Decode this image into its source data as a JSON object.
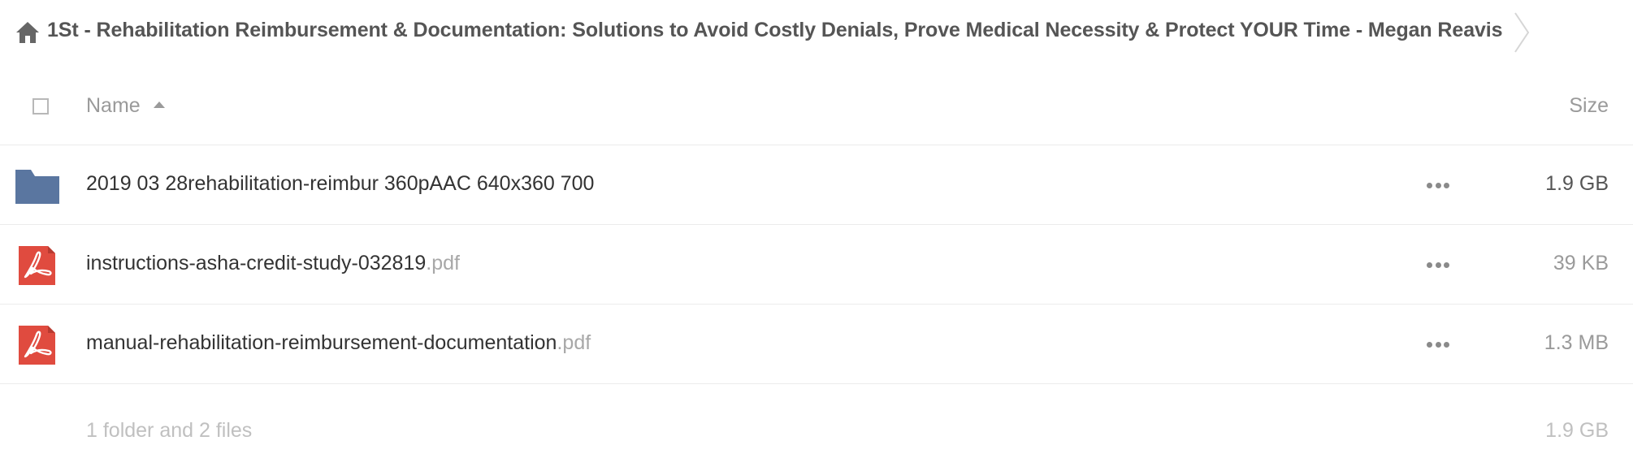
{
  "breadcrumb": {
    "home_icon": "home-icon",
    "title": "1St - Rehabilitation Reimbursement & Documentation: Solutions to Avoid Costly Denials, Prove Medical Necessity & Protect YOUR Time - Megan Reavis"
  },
  "header": {
    "name_label": "Name",
    "size_label": "Size",
    "sort": "ascending"
  },
  "files": [
    {
      "icon": "folder-icon",
      "name": "2019 03 28rehabilitation-reimbur 360pAAC 640x360 700",
      "ext": "",
      "size": "1.9 GB"
    },
    {
      "icon": "pdf-icon",
      "name": "instructions-asha-credit-study-032819",
      "ext": ".pdf",
      "size": "39 KB"
    },
    {
      "icon": "pdf-icon",
      "name": "manual-rehabilitation-reimbursement-documentation",
      "ext": ".pdf",
      "size": "1.3 MB"
    }
  ],
  "summary": {
    "text": "1 folder and 2 files",
    "size": "1.9 GB"
  },
  "colors": {
    "folder": "#5a76a0",
    "pdf": "#e04b3f",
    "text": "#333333",
    "muted": "#9a9a9a",
    "divider": "#ececec"
  }
}
